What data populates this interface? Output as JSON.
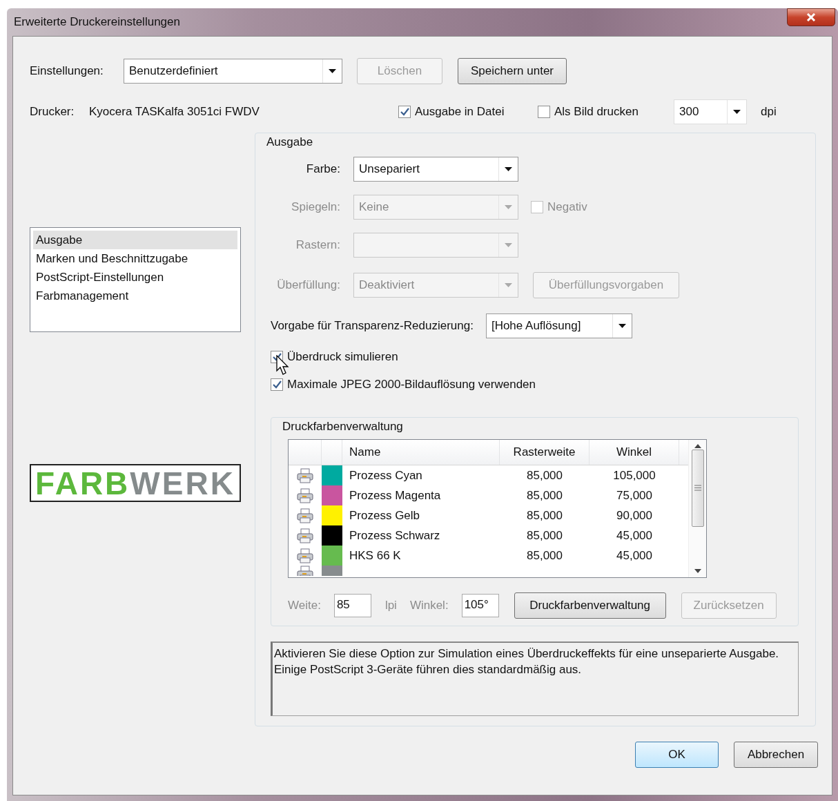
{
  "window": {
    "title": "Erweiterte Druckereinstellungen"
  },
  "settings": {
    "label": "Einstellungen:",
    "value": "Benutzerdefiniert"
  },
  "top_buttons": [
    {
      "label": "Löschen",
      "disabled": true
    },
    {
      "label": "Speichern unter",
      "disabled": false
    }
  ],
  "printer": {
    "label": "Drucker:",
    "value": "Kyocera TASKalfa 3051ci FWDV"
  },
  "options": [
    {
      "label": "Ausgabe in Datei",
      "checked": true
    },
    {
      "label": "Als Bild drucken",
      "checked": false
    }
  ],
  "resolution": {
    "value": "300",
    "unit": "dpi"
  },
  "sidebar": {
    "items": [
      {
        "label": "Ausgabe",
        "selected": true
      },
      {
        "label": "Marken und Beschnittzugabe",
        "selected": false
      },
      {
        "label": "PostScript-Einstellungen",
        "selected": false
      },
      {
        "label": "Farbmanagement",
        "selected": false
      }
    ]
  },
  "logo": {
    "parts": [
      {
        "text": "FARB",
        "color": "#5cb83c"
      },
      {
        "text": "WERK",
        "color": "#858b8c"
      }
    ]
  },
  "output": {
    "title": "Ausgabe",
    "fields": [
      {
        "label": "Farbe:",
        "value": "Unsepariert",
        "disabled": false
      },
      {
        "label": "Spiegeln:",
        "value": "Keine",
        "disabled": true,
        "checkbox": {
          "label": "Negativ",
          "checked": false,
          "disabled": true
        }
      },
      {
        "label": "Rastern:",
        "disabled": true
      },
      {
        "label": "Überfüllung:",
        "value": "Deaktiviert",
        "disabled": true,
        "button": {
          "label": "Überfüllungsvorgaben",
          "disabled": true
        }
      }
    ],
    "transparency": {
      "label": "Vorgabe für Transparenz-Reduzierung:",
      "value": "[Hohe Auflösung]"
    },
    "checkboxes": [
      {
        "label": "Überdruck simulieren",
        "checked": true
      },
      {
        "label": "Maximale JPEG 2000-Bildauflösung verwenden",
        "checked": true
      }
    ]
  },
  "inks": {
    "title": "Druckfarbenverwaltung",
    "columns": [
      "Name",
      "Rasterweite",
      "Winkel"
    ],
    "rows": [
      {
        "name": "Prozess Cyan",
        "ruling": "85,000",
        "angle": "105,000",
        "color": "#00aaa0"
      },
      {
        "name": "Prozess Magenta",
        "ruling": "85,000",
        "angle": "75,000",
        "color": "#c9559f"
      },
      {
        "name": "Prozess Gelb",
        "ruling": "85,000",
        "angle": "90,000",
        "color": "#fff100"
      },
      {
        "name": "Prozess Schwarz",
        "ruling": "85,000",
        "angle": "45,000",
        "color": "#000000"
      },
      {
        "name": "HKS 66 K",
        "ruling": "85,000",
        "angle": "45,000",
        "color": "#66bb4f"
      },
      {
        "color": "#878c8e"
      }
    ],
    "width": {
      "label": "Weite:",
      "value": "85",
      "unit": "lpi",
      "disabled": true
    },
    "angle": {
      "label": "Winkel:",
      "value": "105°",
      "disabled": true
    },
    "buttons": [
      {
        "label": "Druckfarbenverwaltung",
        "disabled": false
      },
      {
        "label": "Zurücksetzen",
        "disabled": true
      }
    ]
  },
  "description": "Aktivieren Sie diese Option zur Simulation eines Überdruckeffekts für eine unseparierte Ausgabe. Einige PostScript 3-Geräte führen dies standardmäßig aus.",
  "footer_buttons": [
    {
      "label": "OK",
      "default": true
    },
    {
      "label": "Abbrechen",
      "default": false
    }
  ]
}
